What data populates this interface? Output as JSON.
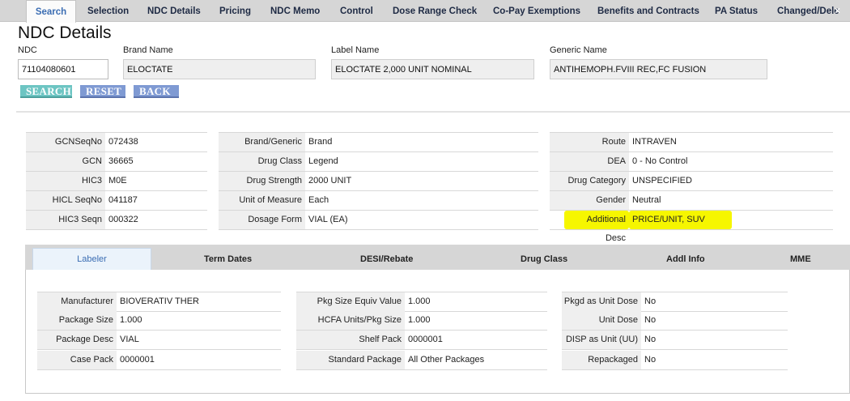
{
  "top_tabs": [
    "Search",
    "Selection",
    "NDC Details",
    "Pricing",
    "NDC Memo",
    "Control",
    "Dose Range Check",
    "Co-Pay Exemptions",
    "Benefits and Contracts",
    "PA Status",
    "Changed/Dele"
  ],
  "close_glyph": "×",
  "page_title": "NDC Details",
  "fields": {
    "ndc_label": "NDC",
    "ndc_value": "71104080601",
    "brand_label": "Brand Name",
    "brand_value": "ELOCTATE",
    "labelname_label": "Label Name",
    "labelname_value": "ELOCTATE 2,000 UNIT NOMINAL",
    "generic_label": "Generic Name",
    "generic_value": "ANTIHEMOPH.FVIII REC,FC FUSION"
  },
  "buttons": {
    "search": "SEARCH",
    "reset": "RESET",
    "back": "BACK"
  },
  "info": {
    "col1": [
      {
        "label": "GCNSeqNo",
        "value": "072438"
      },
      {
        "label": "GCN",
        "value": "36665"
      },
      {
        "label": "HIC3",
        "value": "M0E"
      },
      {
        "label": "HICL SeqNo",
        "value": "041187"
      },
      {
        "label": "HIC3 Seqn",
        "value": "000322"
      }
    ],
    "col2": [
      {
        "label": "Brand/Generic",
        "value": "Brand"
      },
      {
        "label": "Drug Class",
        "value": "Legend"
      },
      {
        "label": "Drug Strength",
        "value": "2000 UNIT"
      },
      {
        "label": "Unit of Measure",
        "value": "Each"
      },
      {
        "label": "Dosage Form",
        "value": "VIAL (EA)"
      }
    ],
    "col3": [
      {
        "label": "Route",
        "value": "INTRAVEN"
      },
      {
        "label": "DEA",
        "value": "0 - No Control"
      },
      {
        "label": "Drug Category",
        "value": "UNSPECIFIED"
      },
      {
        "label": "Gender",
        "value": "Neutral"
      },
      {
        "label": "Additional Desc",
        "value": "PRICE/UNIT, SUV"
      }
    ]
  },
  "highlight_color": "#f6f600",
  "panel_tabs": [
    "Labeler",
    "Term Dates",
    "DESI/Rebate",
    "Drug Class",
    "Addl Info",
    "MME"
  ],
  "labeler": {
    "col1": [
      {
        "label": "Manufacturer",
        "value": "BIOVERATIV THER"
      },
      {
        "label": "Package Size",
        "value": "1.000"
      },
      {
        "label": "Package Desc",
        "value": "VIAL"
      },
      {
        "label": "Case Pack",
        "value": "0000001"
      }
    ],
    "col2": [
      {
        "label": "Pkg Size Equiv Value",
        "value": "1.000"
      },
      {
        "label": "HCFA Units/Pkg Size",
        "value": "1.000"
      },
      {
        "label": "Shelf Pack",
        "value": "0000001"
      },
      {
        "label": "Standard Package",
        "value": "All Other Packages"
      }
    ],
    "col3": [
      {
        "label": "Pkgd as Unit Dose",
        "value": "No"
      },
      {
        "label": "Unit Dose",
        "value": "No"
      },
      {
        "label": "DISP as Unit (UU)",
        "value": "No"
      },
      {
        "label": "Repackaged",
        "value": "No"
      }
    ]
  }
}
